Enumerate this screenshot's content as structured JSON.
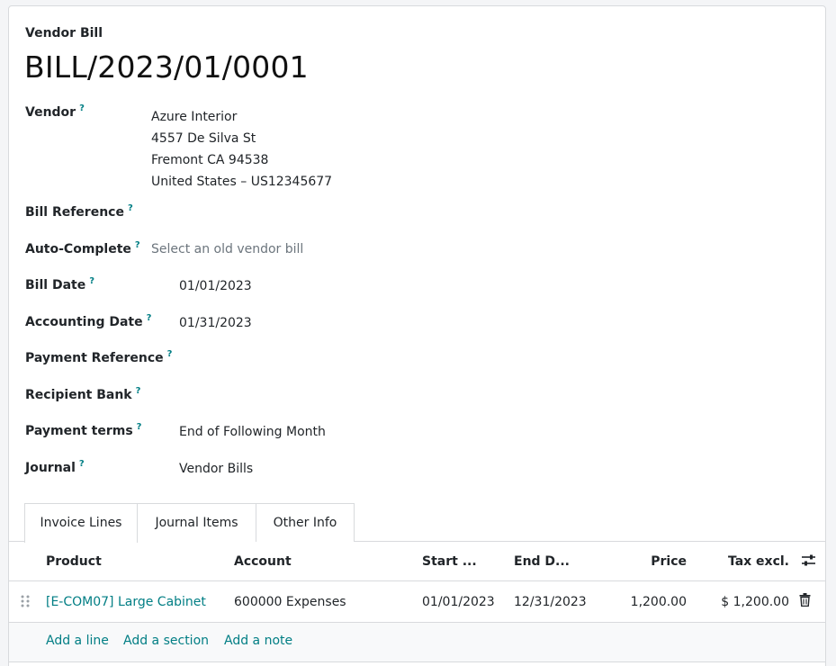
{
  "header": {
    "doc_type": "Vendor Bill",
    "doc_name": "BILL/2023/01/0001"
  },
  "fields": {
    "help_mark": "?",
    "vendor": {
      "label": "Vendor",
      "name": "Azure Interior",
      "street": "4557 De Silva St",
      "city": "Fremont CA 94538",
      "country": "United States – US12345677"
    },
    "bill_reference": {
      "label": "Bill Reference",
      "value": ""
    },
    "auto_complete": {
      "label": "Auto-Complete",
      "placeholder": "Select an old vendor bill"
    },
    "bill_date": {
      "label": "Bill Date",
      "value": "01/01/2023"
    },
    "accounting_date": {
      "label": "Accounting Date",
      "value": "01/31/2023"
    },
    "payment_reference": {
      "label": "Payment Reference",
      "value": ""
    },
    "recipient_bank": {
      "label": "Recipient Bank",
      "value": ""
    },
    "payment_terms": {
      "label": "Payment terms",
      "value": "End of Following Month"
    },
    "journal": {
      "label": "Journal",
      "value": "Vendor Bills"
    }
  },
  "tabs": [
    {
      "label": "Invoice Lines",
      "active": true
    },
    {
      "label": "Journal Items",
      "active": false
    },
    {
      "label": "Other Info",
      "active": false
    }
  ],
  "table": {
    "columns": {
      "product": "Product",
      "account": "Account",
      "start": "Start ...",
      "end": "End D...",
      "price": "Price",
      "tax_excl": "Tax excl."
    },
    "rows": [
      {
        "product": "[E-COM07] Large Cabinet",
        "account": "600000 Expenses",
        "start": "01/01/2023",
        "end": "12/31/2023",
        "price": "1,200.00",
        "tax_excl": "$ 1,200.00"
      }
    ],
    "add_line": "Add a line",
    "add_section": "Add a section",
    "add_note": "Add a note"
  },
  "colors": {
    "accent": "#017e84",
    "border": "#d8dadd",
    "text": "#212529",
    "muted": "#6c757d"
  }
}
